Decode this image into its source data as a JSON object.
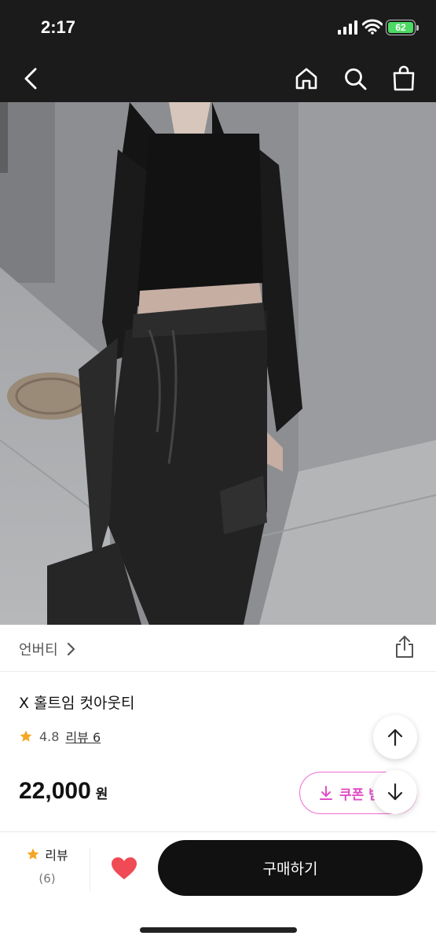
{
  "status_bar": {
    "time": "2:17",
    "battery": "62"
  },
  "nav": {
    "icons": [
      "back-icon",
      "home-icon",
      "search-icon",
      "shopping-bag-icon"
    ]
  },
  "product": {
    "brand": "언버티",
    "name": "X 홀트임 컷아웃티",
    "rating": "4.8",
    "review_link": "리뷰 6",
    "price": "22,000",
    "currency": "원",
    "coupon_label": "쿠폰 받기"
  },
  "bottom_bar": {
    "review_label": "리뷰",
    "review_count": "(6)",
    "buy_label": "구매하기"
  },
  "colors": {
    "accent_pink": "#e04ec6",
    "star": "#f5a623",
    "heart": "#f04a55",
    "buy_button": "#111111"
  }
}
